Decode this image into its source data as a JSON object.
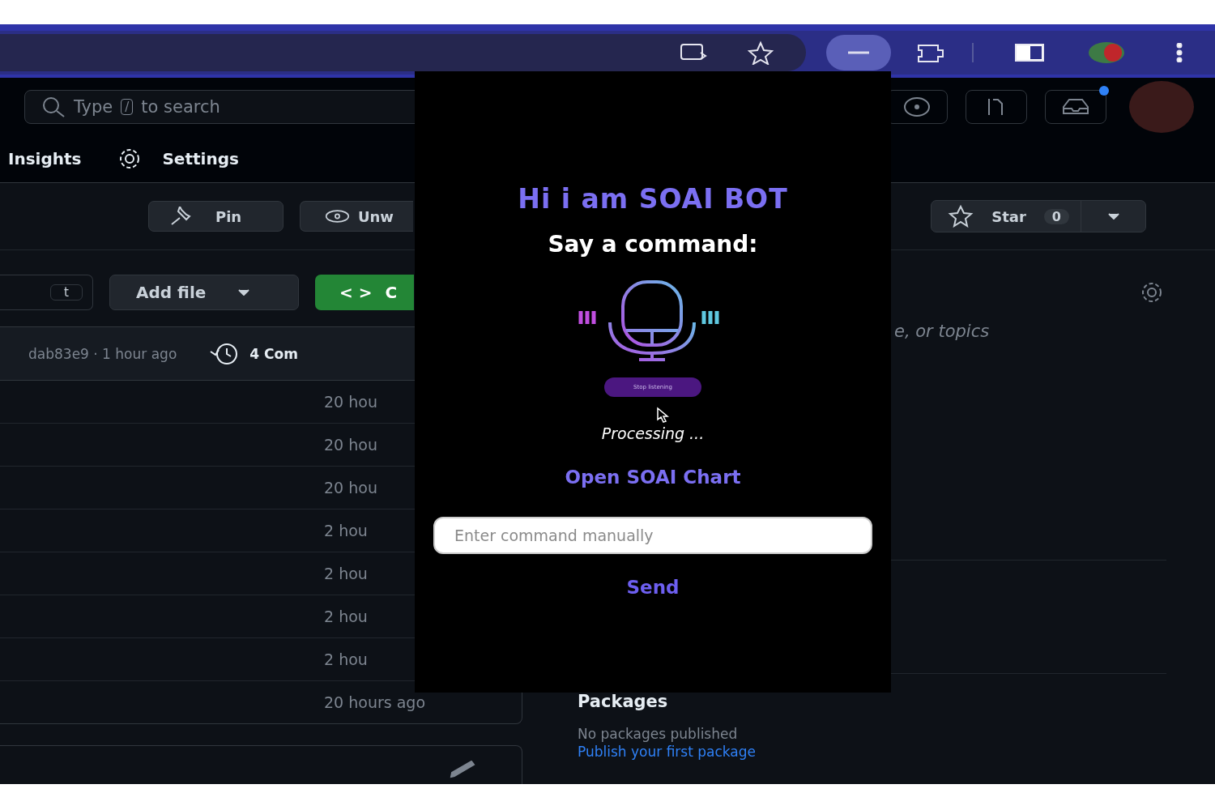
{
  "header": {
    "search": {
      "prefix": "Type",
      "key": "/",
      "suffix": "to search"
    },
    "inbox_unread": true
  },
  "repo_nav": [
    {
      "label": "Insights",
      "kind": "plain"
    },
    {
      "label": "Settings",
      "kind": "gear"
    }
  ],
  "repo_actions": {
    "pin": "Pin",
    "watch": "Unw",
    "star": "Star",
    "star_count": "0"
  },
  "file_toolbar": {
    "key": "t",
    "add_file": "Add file",
    "code_icon": "< >",
    "code": "C"
  },
  "commit_bar": {
    "sha_time": "dab83e9 · 1 hour ago",
    "commits": "4 Com"
  },
  "files": [
    {
      "time": "20 hou"
    },
    {
      "time": "20 hou"
    },
    {
      "time": "20 hou"
    },
    {
      "time": "2 hou"
    },
    {
      "time": "2 hou"
    },
    {
      "time": "2 hou"
    },
    {
      "time": "2 hou"
    },
    {
      "time": "20 hours ago"
    }
  ],
  "about_text": "e, or topics",
  "packages": {
    "title": "Packages",
    "text": "No packages published",
    "link": "Publish your first package"
  },
  "popup": {
    "title": "Hi i am SOAI BOT",
    "prompt": "Say a command:",
    "stop_button": "Stop listening",
    "status": "Processing ...",
    "chart_link": "Open SOAI Chart",
    "input": {
      "placeholder": "Enter command manually"
    },
    "send": "Send"
  }
}
